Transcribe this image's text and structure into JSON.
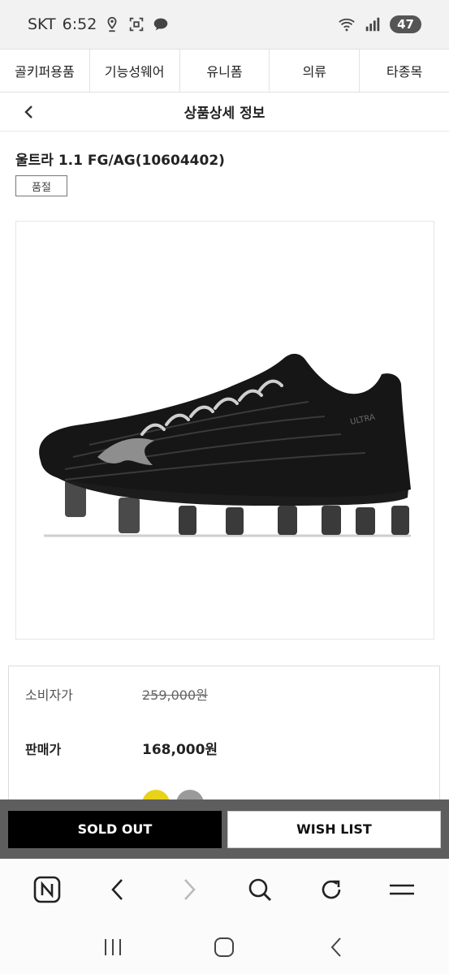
{
  "status_bar": {
    "carrier": "SKT",
    "time": "6:52",
    "battery": "47",
    "icons": [
      "location-icon",
      "screenshot-icon",
      "chat-icon",
      "wifi-icon",
      "signal-icon"
    ]
  },
  "category_tabs": [
    {
      "label": "골키퍼용품"
    },
    {
      "label": "기능성웨어"
    },
    {
      "label": "유니폼"
    },
    {
      "label": "의류"
    },
    {
      "label": "타종목"
    }
  ],
  "header": {
    "title": "상품상세 정보",
    "back_icon": "chevron-left-icon"
  },
  "product": {
    "name": "울트라 1.1 FG/AG(10604402)",
    "status_badge": "품절",
    "image": "black-soccer-cleat"
  },
  "prices": {
    "consumer_label": "소비자가",
    "consumer_price": "259,000원",
    "sale_label": "판매가",
    "sale_price": "168,000원"
  },
  "actions": {
    "sold_out_label": "SOLD OUT",
    "wish_label": "WISH LIST"
  },
  "browser_nav": {
    "icons": [
      "naver-home-icon",
      "back-arrow-icon",
      "forward-arrow-icon",
      "search-icon",
      "refresh-icon",
      "menu-icon"
    ]
  },
  "system_nav": {
    "icons": [
      "recent-apps-icon",
      "home-icon",
      "back-icon"
    ]
  },
  "colors": {
    "action_bar_bg": "#5e5e5e",
    "sold_out_bg": "#000000",
    "swatch_yellow": "#e8d21a",
    "swatch_gray": "#9a9a9a"
  }
}
